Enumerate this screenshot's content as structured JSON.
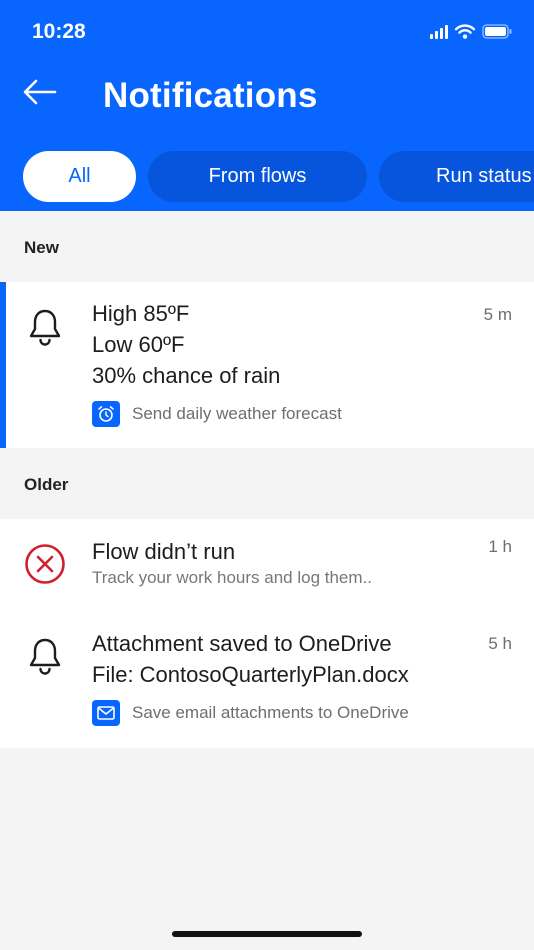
{
  "status_bar": {
    "time": "10:28"
  },
  "header": {
    "title": "Notifications"
  },
  "tabs": [
    {
      "label": "All",
      "active": true
    },
    {
      "label": "From flows",
      "active": false
    },
    {
      "label": "Run status",
      "active": false
    }
  ],
  "sections": {
    "new": {
      "label": "New",
      "items": [
        {
          "icon": "bell-icon",
          "lines": [
            "High 85ºF",
            "Low 60ºF",
            "30% chance of rain"
          ],
          "source_icon": "alarm-clock-icon",
          "source": "Send daily weather forecast",
          "time": "5 m",
          "unread": true
        }
      ]
    },
    "older": {
      "label": "Older",
      "items": [
        {
          "icon": "error-circle-icon",
          "title": "Flow didn’t run",
          "subtext": "Track your work hours and log them..",
          "time": "1 h"
        },
        {
          "icon": "bell-icon",
          "lines": [
            "Attachment saved to OneDrive",
            "File: ContosoQuarterlyPlan.docx"
          ],
          "source_icon": "mail-icon",
          "source": "Save email attachments to OneDrive",
          "time": "5 h"
        }
      ]
    }
  },
  "colors": {
    "accent": "#0866ff",
    "error": "#d0202e",
    "background": "#f4f4f4"
  }
}
